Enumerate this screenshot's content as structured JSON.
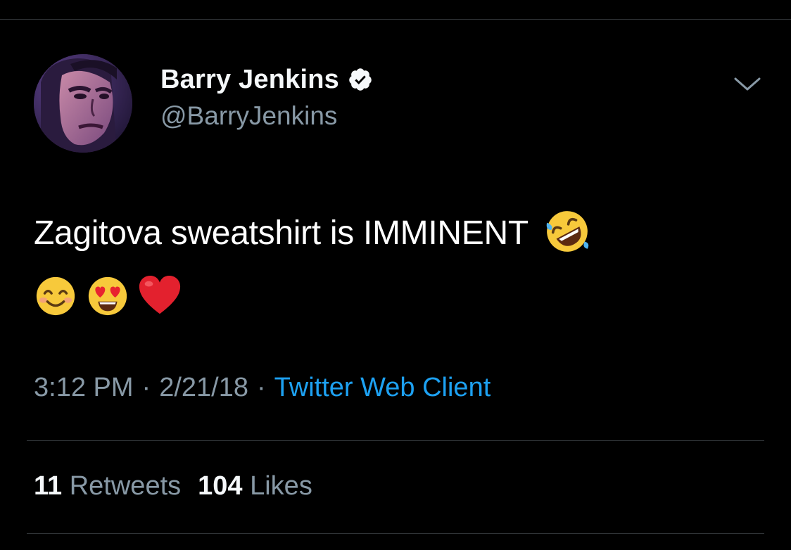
{
  "tweet": {
    "display_name": "Barry Jenkins",
    "handle": "@BarryJenkins",
    "verified": true,
    "text": "Zagitova sweatshirt is IMMINENT",
    "emojis_line1": [
      "rolling-on-floor-laughing"
    ],
    "emojis_line2": [
      "smiling-face-with-smiling-eyes",
      "smiling-face-with-heart-eyes",
      "red-heart"
    ],
    "time": "3:12 PM",
    "date": "2/21/18",
    "separator": "·",
    "source": "Twitter Web Client",
    "retweets_count": "11",
    "retweets_label": "Retweets",
    "likes_count": "104",
    "likes_label": "Likes"
  },
  "colors": {
    "background": "#000000",
    "primary_text": "#ffffff",
    "secondary_text": "#8899a6",
    "link": "#1da1f2",
    "divider": "#2f3336"
  },
  "icons": {
    "verified": "verified-badge-icon",
    "more": "chevron-down-icon"
  }
}
